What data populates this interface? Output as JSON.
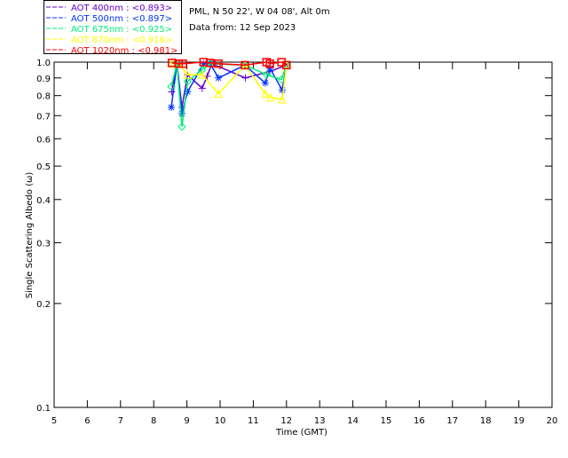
{
  "chart_data": {
    "type": "scatter",
    "title_lines": [
      "PML, N 50 22', W 04 08', Alt 0m",
      "Data from: 12 Sep 2023"
    ],
    "xlabel": "Time (GMT)",
    "ylabel": "Single Scattering Albedo (ω)",
    "xlim": [
      5,
      20
    ],
    "ylim": [
      0.1,
      1.0
    ],
    "yscale": "log",
    "grid": false,
    "legend_position": "top-left, outside plot",
    "xticks": [
      "5",
      "6",
      "7",
      "8",
      "9",
      "10",
      "11",
      "12",
      "13",
      "14",
      "15",
      "16",
      "17",
      "18",
      "19",
      "20"
    ],
    "yticks": [
      "1.0",
      "0.9",
      "0.8",
      "0.7",
      "0.6",
      "0.5",
      "0.4",
      "0.3",
      "0.2",
      "0.1"
    ],
    "series": [
      {
        "name": "AOT  400nm : <0.893>",
        "color": "#6600cc",
        "marker": "plus",
        "x": [
          8.54,
          8.7,
          8.85,
          9.02,
          9.46,
          9.61,
          9.75,
          10.76,
          11.5,
          12.0
        ],
        "y": [
          0.82,
          0.99,
          0.74,
          0.92,
          0.84,
          0.91,
          0.99,
          0.9,
          0.94,
          0.98
        ]
      },
      {
        "name": "AOT  500nm : <0.897>",
        "color": "#0033ff",
        "marker": "asterisk",
        "x": [
          8.53,
          8.7,
          8.85,
          9.02,
          9.5,
          9.7,
          9.95,
          10.75,
          11.36,
          11.5,
          11.87,
          12.0
        ],
        "y": [
          0.74,
          0.99,
          0.71,
          0.82,
          0.99,
          0.99,
          0.9,
          0.98,
          0.87,
          0.96,
          0.83,
          0.98
        ]
      },
      {
        "name": "AOT  675nm : <0.925>",
        "color": "#00ee77",
        "marker": "diamond",
        "x": [
          8.53,
          8.7,
          8.85,
          9.02,
          9.46,
          9.7,
          10.75,
          11.4,
          11.85,
          12.0
        ],
        "y": [
          0.85,
          0.99,
          0.65,
          0.88,
          0.95,
          0.99,
          0.98,
          0.92,
          0.89,
          0.98
        ]
      },
      {
        "name": "AOT  870nm : <0.916>",
        "color": "#ffff00",
        "marker": "triangle",
        "x": [
          8.55,
          8.75,
          9.02,
          9.46,
          9.95,
          10.75,
          11.36,
          11.52,
          11.87,
          12.0
        ],
        "y": [
          0.99,
          0.99,
          0.92,
          0.92,
          0.81,
          0.98,
          0.81,
          0.79,
          0.78,
          0.98
        ]
      },
      {
        "name": "AOT 1020nm : <0.981>",
        "color": "#ff0000",
        "marker": "square",
        "x": [
          8.55,
          8.75,
          8.88,
          9.5,
          9.7,
          9.95,
          10.75,
          11.4,
          11.5,
          11.85,
          12.0
        ],
        "y": [
          0.995,
          0.99,
          0.99,
          1.0,
          0.995,
          0.99,
          0.98,
          1.0,
          0.99,
          1.0,
          0.98
        ]
      }
    ]
  }
}
